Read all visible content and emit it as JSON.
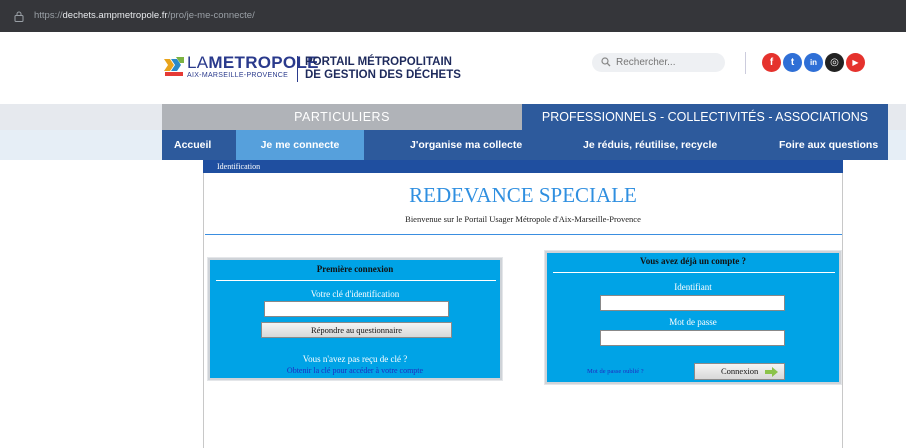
{
  "browser": {
    "url_prefix": "https://",
    "url_host": "dechets.ampmetropole.fr",
    "url_path": "/pro/je-me-connecte/"
  },
  "header": {
    "logo_name_prefix": "LA",
    "logo_name_main": "METROPOLE",
    "logo_sub": "AIX-MARSEILLE-PROVENCE",
    "portal_line1": "PORTAIL MÉTROPOLITAIN",
    "portal_line2": "DE GESTION DES DÉCHETS",
    "search_placeholder": "Rechercher...",
    "social": [
      {
        "name": "facebook-icon",
        "glyph": "f",
        "color": "#e5322d"
      },
      {
        "name": "twitter-icon",
        "glyph": "t",
        "color": "#2f6fd6"
      },
      {
        "name": "linkedin-icon",
        "glyph": "in",
        "color": "#2f6fd6"
      },
      {
        "name": "instagram-icon",
        "glyph": "◎",
        "color": "#222222"
      },
      {
        "name": "youtube-icon",
        "glyph": "▶",
        "color": "#e5322d"
      }
    ]
  },
  "audience_tabs": {
    "particuliers": "PARTICULIERS",
    "pro": "PROFESSIONNELS - COLLECTIVITÉS - ASSOCIATIONS"
  },
  "nav": {
    "accueil": "Accueil",
    "je_me_connecte": "Je me connecte",
    "collecte": "J'organise ma collecte",
    "reduis": "Je réduis, réutilise, recycle",
    "faq": "Foire aux questions"
  },
  "page": {
    "identification_tab": "Identification",
    "title": "REDEVANCE SPECIALE",
    "welcome": "Bienvenue sur le Portail Usager Métropole d'Aix-Marseille-Provence"
  },
  "first_login": {
    "title": "Première connexion",
    "key_label": "Votre clé d'identification",
    "key_value": "",
    "button": "Répondre au questionnaire",
    "no_key": "Vous n'avez pas reçu de clé ?",
    "get_key_link": "Obtenir la clé pour accéder à votre compte"
  },
  "login": {
    "title": "Vous avez déjà un compte ?",
    "id_label": "Identifiant",
    "id_value": "",
    "pwd_label": "Mot de passe",
    "pwd_value": "",
    "forgot_link": "Mot de passe oublié ?",
    "button": "Connexion"
  },
  "colors": {
    "brand_blue": "#2d5a9c",
    "active_nav": "#56a0dc",
    "panel_blue": "#00a3e6",
    "title_blue": "#2f8fe0"
  }
}
